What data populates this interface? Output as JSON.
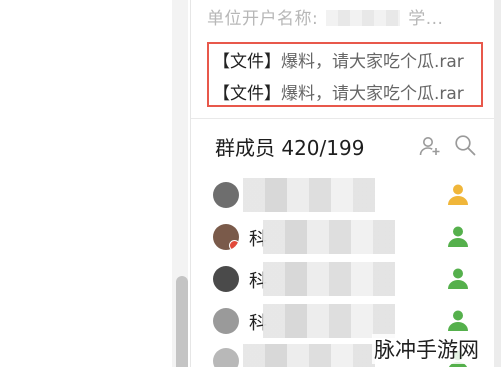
{
  "notice": {
    "label": "单位开户名称:",
    "suffix": "学..."
  },
  "files": [
    {
      "tag": "【文件】",
      "name": "爆料，请大家吃个瓜.rar"
    },
    {
      "tag": "【文件】",
      "name": "爆料，请大家吃个瓜.rar"
    }
  ],
  "members": {
    "title": "群成员 420/199",
    "add_icon": "add-member-icon",
    "search_icon": "search-icon",
    "list": [
      {
        "name": "",
        "avatar_color": "#6e6e6e",
        "role": "owner",
        "role_color": "#f0b63a"
      },
      {
        "name": "科",
        "avatar_color": "#7a5a4a",
        "role": "admin",
        "role_color": "#55b04c",
        "badge": true
      },
      {
        "name": "科",
        "avatar_color": "#4a4a4a",
        "role": "admin",
        "role_color": "#55b04c"
      },
      {
        "name": "科",
        "avatar_color": "#9a9a9a",
        "role": "admin",
        "role_color": "#55b04c"
      },
      {
        "name": "",
        "avatar_color": "#b8b8b8",
        "role": "admin",
        "role_color": "#55b04c"
      }
    ]
  },
  "watermark": "脉冲手游网",
  "colors": {
    "highlight_border": "#e8584b",
    "owner": "#f0b63a",
    "admin": "#55b04c"
  }
}
